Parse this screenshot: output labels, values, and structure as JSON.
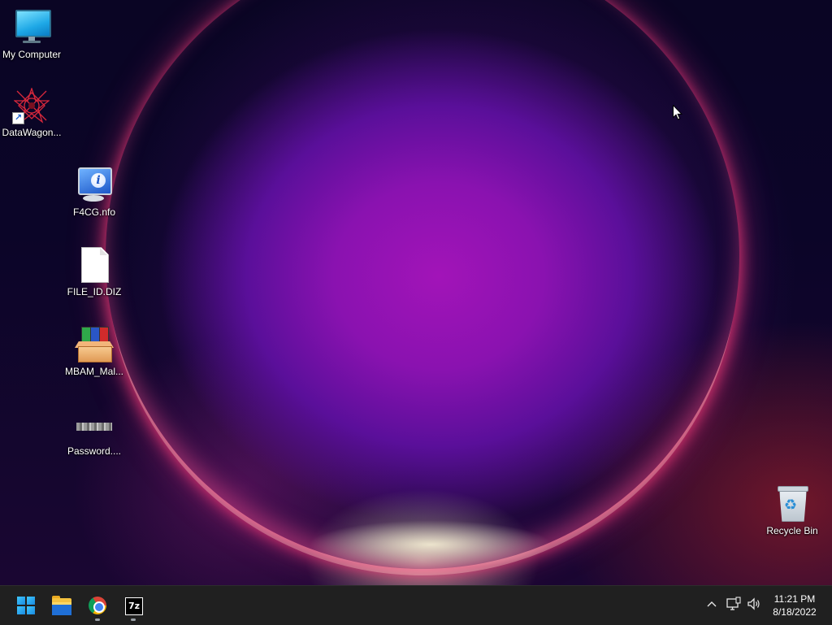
{
  "desktop": {
    "icons": [
      {
        "label": "My Computer",
        "icon": "monitor-icon"
      },
      {
        "label": "DataWagon...",
        "icon": "starburst-icon"
      },
      {
        "label": "F4CG.nfo",
        "icon": "info-icon"
      },
      {
        "label": "FILE_ID.DIZ",
        "icon": "file-icon"
      },
      {
        "label": "MBAM_Mal...",
        "icon": "winrar-archive-icon"
      },
      {
        "label": "Password....",
        "icon": "image-thumbnail-icon"
      },
      {
        "label": "Recycle Bin",
        "icon": "recycle-bin-icon"
      }
    ]
  },
  "taskbar": {
    "pinned": [
      {
        "name": "Start",
        "icon": "windows-logo-icon",
        "running": false
      },
      {
        "name": "File Explorer",
        "icon": "folder-icon",
        "running": false
      },
      {
        "name": "Google Chrome",
        "icon": "chrome-icon",
        "running": true
      },
      {
        "name": "7-Zip",
        "icon": "7zip-icon",
        "running": true
      }
    ],
    "sevenzip_glyph": "7z",
    "tray": {
      "chevron": "^",
      "network_icon": "network-icon",
      "volume_icon": "volume-icon"
    },
    "clock": {
      "time": "11:21 PM",
      "date": "8/18/2022"
    }
  },
  "colors": {
    "taskbar_bg": "#202020",
    "wallpaper_accent": "#a214b8",
    "windows_blue": "#1a8ae0"
  }
}
